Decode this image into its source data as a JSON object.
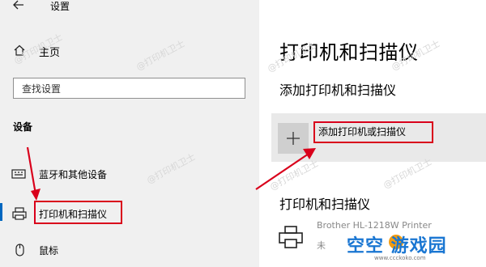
{
  "window": {
    "title": "设置"
  },
  "sidebar": {
    "home_label": "主页",
    "search_placeholder": "查找设置",
    "section_heading": "设备",
    "items": [
      {
        "label": "蓝牙和其他设备",
        "icon": "keyboard-icon",
        "selected": false
      },
      {
        "label": "打印机和扫描仪",
        "icon": "printer-icon",
        "selected": true
      },
      {
        "label": "鼠标",
        "icon": "mouse-icon",
        "selected": false
      }
    ]
  },
  "main": {
    "page_title": "打印机和扫描仪",
    "add_heading": "添加打印机和扫描仪",
    "add_button_label": "添加打印机或扫描仪",
    "printers_heading": "打印机和扫描仪",
    "printer": {
      "name": "Brother HL-1218W Printer",
      "status": "未"
    }
  },
  "watermark": "@打印机卫士",
  "logo": {
    "text": "空空 游戏园",
    "sub": "www.ccckoko.com"
  },
  "colors": {
    "accent": "#0067c0",
    "annotation_red": "#d9001b",
    "sidebar_bg": "#f0f0f0",
    "add_row_bg": "#e9e9e9"
  }
}
